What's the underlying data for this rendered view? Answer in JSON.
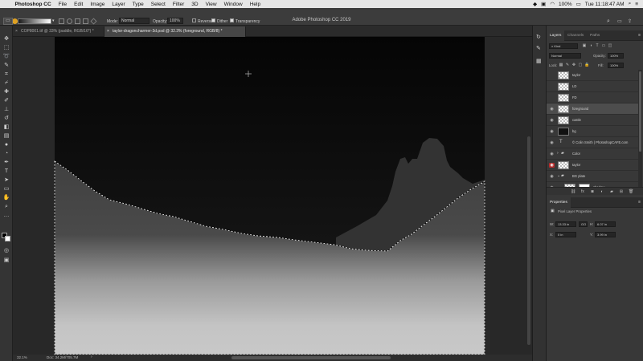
{
  "menubar": {
    "apple": "",
    "items": [
      "Photoshop CC",
      "File",
      "Edit",
      "Image",
      "Layer",
      "Type",
      "Select",
      "Filter",
      "3D",
      "View",
      "Window",
      "Help"
    ],
    "battery": "100%",
    "clock": "Tue 11:18:47 AM",
    "icons": [
      "dropbox-icon",
      "camera-icon",
      "wifi-icon",
      "battery-icon",
      "search-icon",
      "menu-icon"
    ]
  },
  "window": {
    "title": "Adobe Photoshop CC 2019"
  },
  "options": {
    "mode_label": "Mode:",
    "mode_value": "Normal",
    "opacity_label": "Opacity:",
    "opacity_value": "100%",
    "reverse_label": "Reverse",
    "dither_label": "Dither",
    "transparency_label": "Transparency"
  },
  "tabs": [
    {
      "label": "COP8001.tif @ 33% (paddle, RGB/16*) *",
      "active": false
    },
    {
      "label": "taylor-dragoncharmer-3d.psd @ 32.3% (foreground, RGB/8) *",
      "active": true
    }
  ],
  "status": {
    "zoom": "32.1%",
    "doc": "Doc: 34.2M/705.7M",
    "arrow": "›"
  },
  "layers_panel": {
    "tabs": [
      "Layers",
      "Channels",
      "Paths"
    ],
    "kind_label": "Kind",
    "blend_mode": "Normal",
    "opacity_label": "Opacity:",
    "opacity_value": "100%",
    "lock_label": "Lock:",
    "fill_label": "Fill:",
    "fill_value": "100%",
    "layers": [
      {
        "name": "taylor",
        "visible": false,
        "thumb": "checker",
        "selected": false
      },
      {
        "name": "LD",
        "visible": false,
        "thumb": "checker",
        "selected": false
      },
      {
        "name": "FD",
        "visible": false,
        "thumb": "checker",
        "selected": false
      },
      {
        "name": "foreground",
        "visible": true,
        "thumb": "checker",
        "selected": true
      },
      {
        "name": "castle",
        "visible": true,
        "thumb": "checker",
        "selected": false
      },
      {
        "name": "bg",
        "visible": true,
        "thumb": "black",
        "selected": false
      },
      {
        "name": "© Colin Smith | PhotoshopCAFE.com",
        "visible": true,
        "thumb": "text",
        "selected": false
      },
      {
        "name": "Color",
        "visible": true,
        "thumb": "folder",
        "selected": false
      },
      {
        "name": "taylor",
        "visible": true,
        "thumb": "checker",
        "selected": false,
        "red": true
      },
      {
        "name": "BG plate",
        "visible": true,
        "thumb": "folder",
        "selected": false
      },
      {
        "name": "shadow",
        "visible": true,
        "thumb": "mix",
        "selected": false
      }
    ]
  },
  "properties_panel": {
    "title": "Properties",
    "subtitle": "Pixel Layer Properties",
    "w_label": "W:",
    "w_value": "13.33 in",
    "go_label": "GO",
    "h_label": "H:",
    "h_value": "6.07 in",
    "x_label": "X:",
    "x_value": "0 in",
    "y_label": "Y:",
    "y_value": "3.99 in"
  },
  "colors": {
    "menubar": "#e6e6e6",
    "panel": "#383838",
    "selected_layer": "#4d4d4d",
    "red_eye": "#b52a2a"
  }
}
